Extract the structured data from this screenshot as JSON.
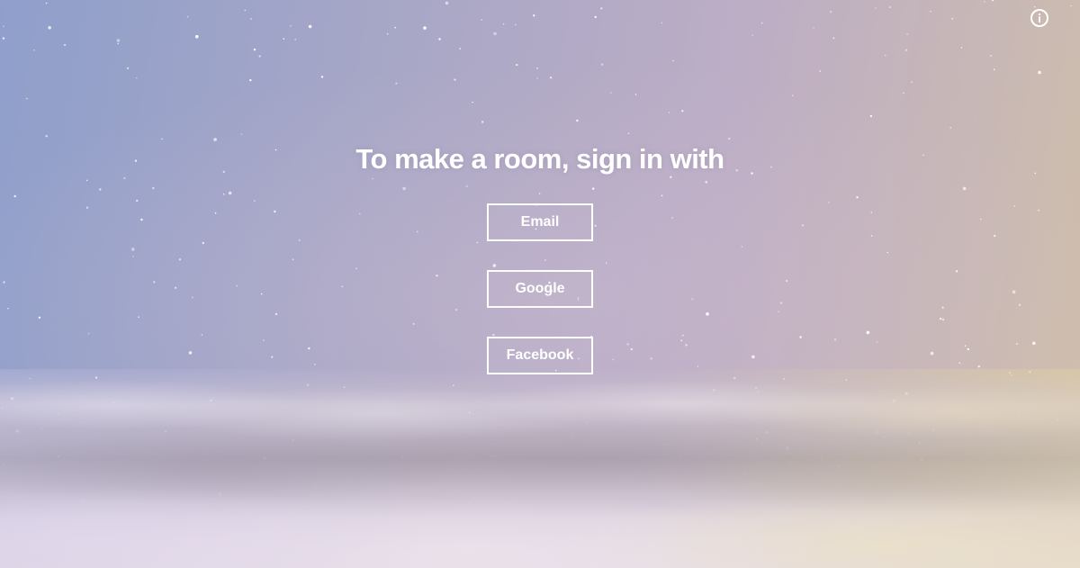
{
  "heading": "To make a room, sign in with",
  "buttons": {
    "email": "Email",
    "google": "Google",
    "facebook": "Facebook"
  },
  "icons": {
    "info": "info-icon"
  },
  "colors": {
    "text": "#ffffff",
    "sky_left": "#8f9fcb",
    "sky_right": "#d0bfa9"
  }
}
